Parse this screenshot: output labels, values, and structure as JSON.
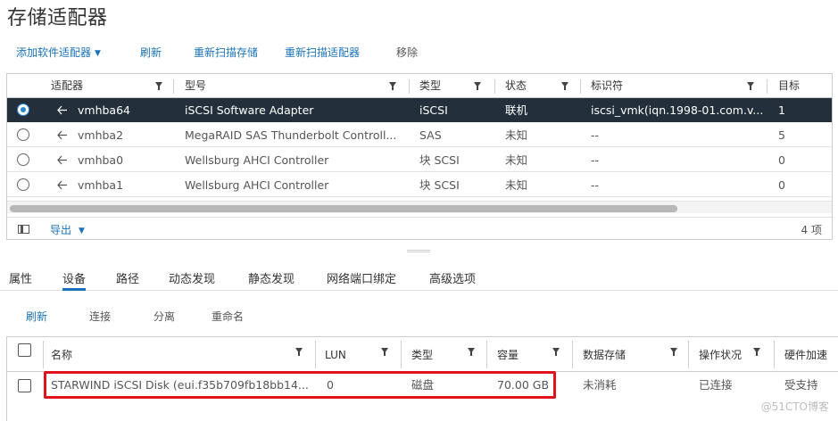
{
  "page_title": "存储适配器",
  "toolbar": {
    "add_software_adapter": "添加软件适配器",
    "refresh": "刷新",
    "rescan_storage": "重新扫描存储",
    "rescan_adapter": "重新扫描适配器",
    "remove": "移除"
  },
  "adapters": {
    "columns": [
      "适配器",
      "型号",
      "类型",
      "状态",
      "标识符",
      "目标"
    ],
    "rows": [
      {
        "adapter": "vmhba64",
        "model": "iSCSI Software Adapter",
        "type": "iSCSI",
        "status": "联机",
        "identifier": "iscsi_vmk(iqn.1998-01.com.v...",
        "targets": "1",
        "selected": true
      },
      {
        "adapter": "vmhba2",
        "model": "MegaRAID SAS Thunderbolt Controll...",
        "type": "SAS",
        "status": "未知",
        "identifier": "--",
        "targets": "5",
        "selected": false
      },
      {
        "adapter": "vmhba0",
        "model": "Wellsburg AHCI Controller",
        "type": "块 SCSI",
        "status": "未知",
        "identifier": "--",
        "targets": "0",
        "selected": false
      },
      {
        "adapter": "vmhba1",
        "model": "Wellsburg AHCI Controller",
        "type": "块 SCSI",
        "status": "未知",
        "identifier": "--",
        "targets": "0",
        "selected": false
      }
    ],
    "export_label": "导出",
    "count_label": "4 项"
  },
  "tabs": [
    "属性",
    "设备",
    "路径",
    "动态发现",
    "静态发现",
    "网络端口绑定",
    "高级选项"
  ],
  "active_tab": "设备",
  "device_toolbar": {
    "refresh": "刷新",
    "attach": "连接",
    "detach": "分离",
    "rename": "重命名"
  },
  "devices": {
    "columns": [
      "名称",
      "LUN",
      "类型",
      "容量",
      "数据存储",
      "操作状况",
      "硬件加速"
    ],
    "rows": [
      {
        "name": "STARWIND iSCSI Disk (eui.f35b709fb18bb14...",
        "lun": "0",
        "type": "磁盘",
        "capacity": "70.00 GB",
        "datastore": "未消耗",
        "op_state": "已连接",
        "hw_accel": "受支持"
      }
    ]
  },
  "watermark": "@51CTO博客",
  "colors": {
    "selected_row": "#23303c",
    "link_blue": "#1a73b8",
    "highlight_red": "#e0121c",
    "radio_blue": "#2a8ad4"
  },
  "icons": [
    "chevron-down-icon",
    "filter-icon",
    "radio-icon",
    "adapter-icon",
    "column-toggle-icon",
    "checkbox-icon"
  ]
}
